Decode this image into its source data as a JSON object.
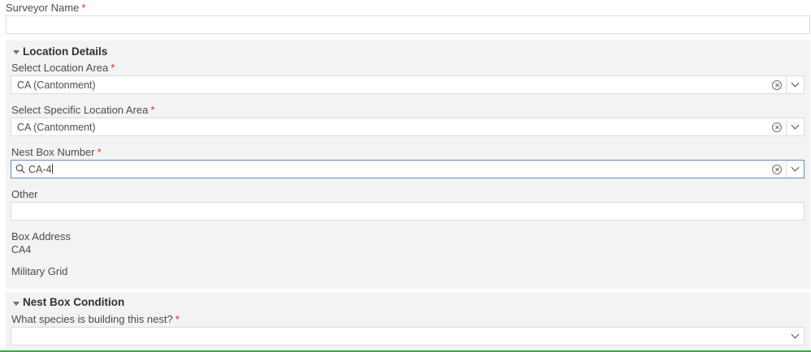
{
  "surveyor": {
    "label": "Surveyor Name",
    "required": "*",
    "value": ""
  },
  "location_details": {
    "title": "Location Details",
    "location_area": {
      "label": "Select Location Area",
      "required": "*",
      "value": "CA (Cantonment)"
    },
    "specific_area": {
      "label": "Select Specific Location Area",
      "required": "*",
      "value": "CA (Cantonment)"
    },
    "nest_box_number": {
      "label": "Nest Box Number",
      "required": "*",
      "value": "CA-4"
    },
    "other": {
      "label": "Other",
      "value": ""
    },
    "box_address": {
      "label": "Box Address",
      "value": "CA4"
    },
    "military_grid": {
      "label": "Military Grid"
    }
  },
  "nest_box_condition": {
    "title": "Nest Box Condition",
    "species": {
      "label": "What species is building this nest?",
      "required": "*",
      "value": ""
    }
  },
  "icons": {
    "clear": "clear-circle-x-icon",
    "dropdown": "chevron-down-icon",
    "search": "search-icon",
    "collapse": "caret-down-icon"
  }
}
